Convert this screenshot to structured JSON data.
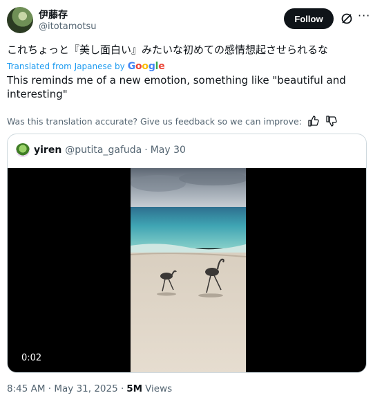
{
  "author": {
    "display_name": "伊藤存",
    "handle": "@itotamotsu"
  },
  "header": {
    "follow_label": "Follow",
    "grok_icon": "grok-icon",
    "more_icon": "more-icon"
  },
  "post": {
    "original_text": "これちょっと『美し面白い』みたいな初めての感情想起させられるな",
    "translated_from": "Translated from Japanese by",
    "translator_brand": [
      "G",
      "o",
      "o",
      "g",
      "l",
      "e"
    ],
    "translation_text": "This reminds me of a new emotion, something like \"beautiful and interesting\"",
    "feedback_prompt": "Was this translation accurate? Give us feedback so we can improve:",
    "feedback_icons": [
      "thumbs-up-icon",
      "thumbs-down-icon"
    ]
  },
  "quoted_post": {
    "display_name": "yiren",
    "handle": "@putita_gafuda",
    "separator": "·",
    "date": "May 30",
    "video_time": "0:02"
  },
  "meta": {
    "time": "8:45 AM · May 31, 2025 ·",
    "views_count": "5M",
    "views_label": "Views"
  },
  "colors": {
    "link": "#1d9bf0",
    "text": "#0f1419",
    "secondary": "#536471",
    "border": "#cfd9de",
    "follow_bg": "#0f1419"
  }
}
